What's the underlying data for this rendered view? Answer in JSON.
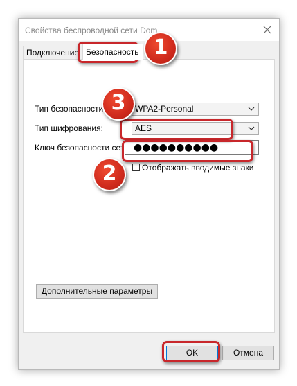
{
  "window": {
    "title": "Свойства беспроводной сети Dom"
  },
  "tabs": [
    {
      "label": "Подключение",
      "active": false
    },
    {
      "label": "Безопасность",
      "active": true
    }
  ],
  "security": {
    "type_label": "Тип безопасности:",
    "type_value": "WPA2-Personal",
    "encryption_label": "Тип шифрования:",
    "encryption_value": "AES",
    "key_label": "Ключ безопасности сети",
    "key_value": "●●●●●●●●●●",
    "show_chars_label": "Отображать вводимые знаки",
    "show_chars_checked": false,
    "advanced_button": "Дополнительные параметры"
  },
  "footer": {
    "ok_button": "OK",
    "cancel_button": "Отмена"
  },
  "annotations": {
    "badge_1": "1",
    "badge_2": "2",
    "badge_3": "3",
    "highlight_color": "#c8272b"
  }
}
